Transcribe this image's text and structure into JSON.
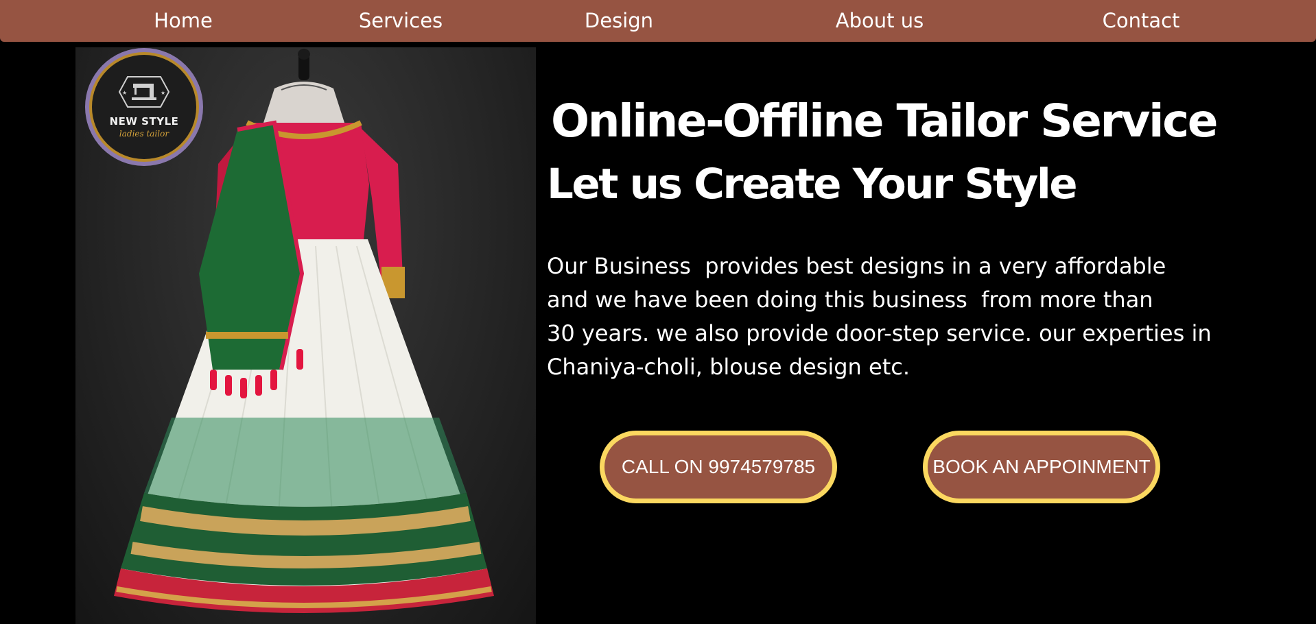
{
  "nav": {
    "items": [
      {
        "label": "Home"
      },
      {
        "label": "Services"
      },
      {
        "label": "Design"
      },
      {
        "label": "About us"
      },
      {
        "label": "Contact"
      }
    ]
  },
  "logo": {
    "name": "NEW STYLE",
    "tagline": "ladies tailor",
    "icon": "sewing-machine-icon"
  },
  "hero": {
    "title_line_1": "Online-Offline Tailor Service",
    "title_line_2": "Let us Create Your Style",
    "description_lines": [
      "Our Business  provides best designs in a very affordable",
      "and we have been doing this business  from more than",
      "30 years. we also provide door-step service. our experties in",
      "Chaniya-choli, blouse design etc."
    ],
    "image_subject": "lehenga-choli-dress-photo"
  },
  "buttons": {
    "call_label": "CALL ON 9974579785",
    "book_label": "BOOK AN APPOINMENT"
  },
  "colors": {
    "nav_bg": "#965442",
    "button_bg": "#965442",
    "button_border": "#fbd860",
    "page_bg": "#000000",
    "text": "#ffffff"
  }
}
